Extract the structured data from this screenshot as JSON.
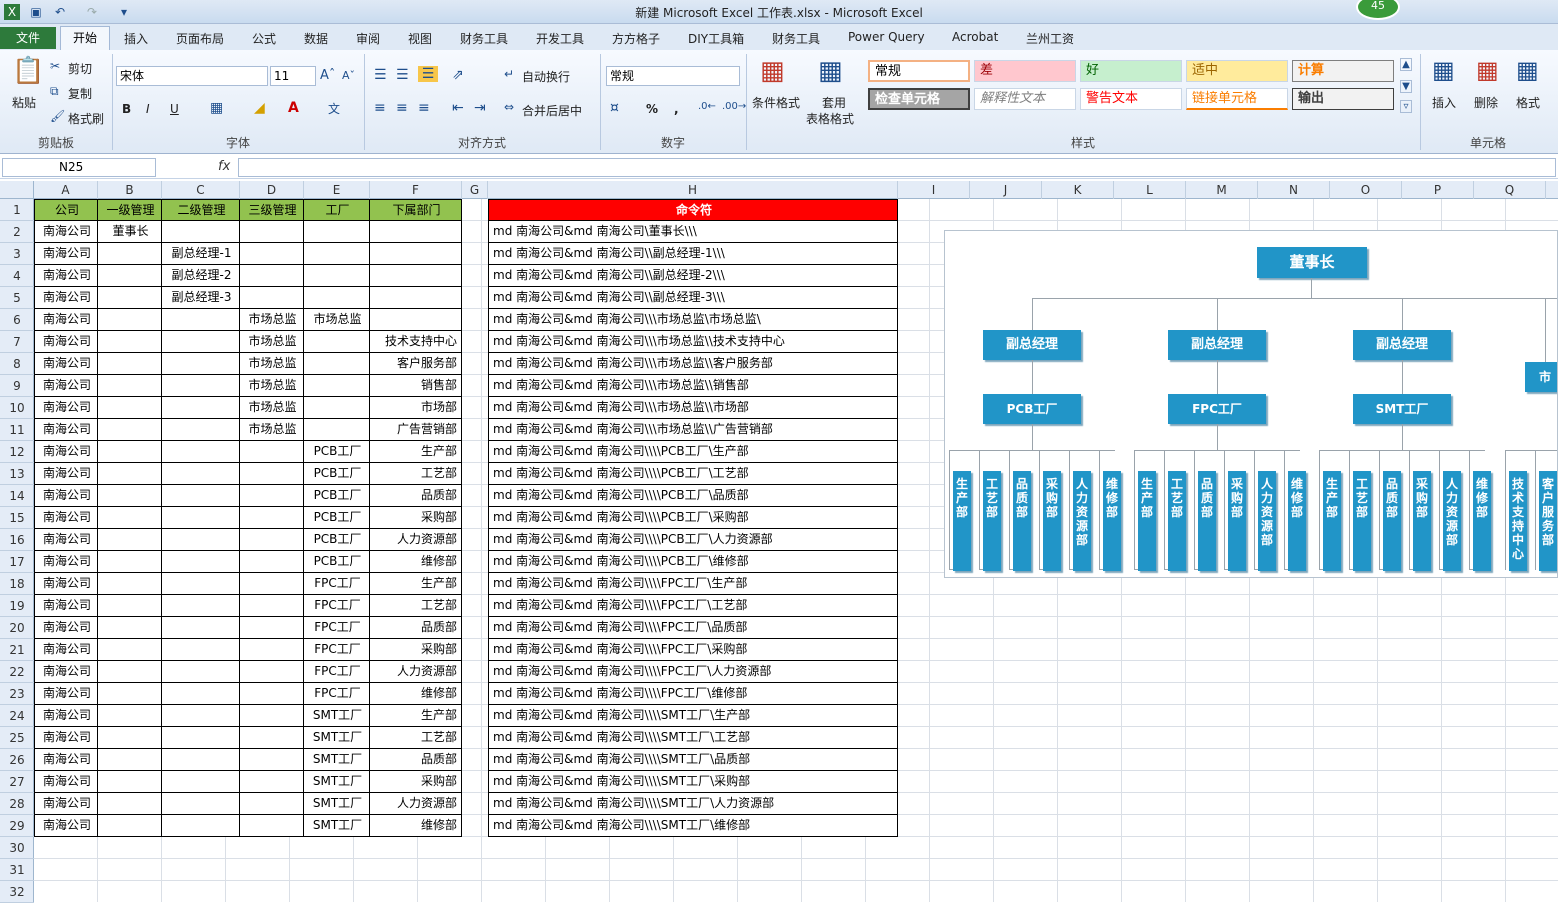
{
  "window": {
    "title": "新建 Microsoft Excel 工作表.xlsx - Microsoft Excel",
    "badge": "45"
  },
  "ribbon_tabs": [
    "文件",
    "开始",
    "插入",
    "页面布局",
    "公式",
    "数据",
    "审阅",
    "视图",
    "财务工具",
    "开发工具",
    "方方格子",
    "DIY工具箱",
    "财务工具",
    "Power Query",
    "Acrobat",
    "兰州工资"
  ],
  "ribbon": {
    "clipboard": {
      "paste": "粘贴",
      "cut": "剪切",
      "copy": "复制",
      "format_painter": "格式刷",
      "label": "剪贴板"
    },
    "font": {
      "name": "宋体",
      "size": "11",
      "bold": "B",
      "italic": "I",
      "underline": "U",
      "label": "字体"
    },
    "alignment": {
      "wrap": "自动换行",
      "merge": "合并后居中",
      "label": "对齐方式"
    },
    "number": {
      "format": "常规",
      "percent": "%",
      "comma": ",",
      "label": "数字"
    },
    "styles": {
      "cond_format": "条件格式",
      "table_format_1": "套用",
      "table_format_2": "表格格式",
      "cells": [
        {
          "text": "常规",
          "bg": "#ffffff",
          "color": "#000000"
        },
        {
          "text": "差",
          "bg": "#ffc7ce",
          "color": "#9c0006"
        },
        {
          "text": "好",
          "bg": "#c6efce",
          "color": "#006100"
        },
        {
          "text": "适中",
          "bg": "#ffeb9c",
          "color": "#9c6500"
        },
        {
          "text": "计算",
          "bg": "#f2f2f2",
          "color": "#fa7d00"
        },
        {
          "text": "检查单元格",
          "bg": "#a5a5a5",
          "color": "#ffffff"
        },
        {
          "text": "解释性文本",
          "bg": "#ffffff",
          "color": "#7f7f7f"
        },
        {
          "text": "警告文本",
          "bg": "#ffffff",
          "color": "#ff0000"
        },
        {
          "text": "链接单元格",
          "bg": "#ffffff",
          "color": "#fa7d00"
        },
        {
          "text": "输出",
          "bg": "#f2f2f2",
          "color": "#3f3f3f"
        }
      ],
      "label": "样式"
    },
    "cells_group": {
      "insert": "插入",
      "delete": "删除",
      "format": "格式",
      "label": "单元格"
    }
  },
  "formula_bar": {
    "name_box": "N25",
    "fx": "fx",
    "formula": ""
  },
  "columns": [
    "A",
    "B",
    "C",
    "D",
    "E",
    "F",
    "G",
    "H",
    "I",
    "J",
    "K",
    "L",
    "M",
    "N",
    "O",
    "P",
    "Q"
  ],
  "rows": [
    "1",
    "2",
    "3",
    "4",
    "5",
    "6",
    "7",
    "8",
    "9",
    "10",
    "11",
    "12",
    "13",
    "14",
    "15",
    "16",
    "17",
    "18",
    "19",
    "20",
    "21",
    "22",
    "23",
    "24",
    "25",
    "26",
    "27",
    "28",
    "29",
    "30",
    "31",
    "32"
  ],
  "table": {
    "headers": [
      "公司",
      "一级管理",
      "二级管理",
      "三级管理",
      "工厂",
      "下属部门"
    ],
    "command_header": "命令符",
    "data": [
      [
        "南海公司",
        "董事长",
        "",
        "",
        "",
        ""
      ],
      [
        "南海公司",
        "",
        "副总经理-1",
        "",
        "",
        ""
      ],
      [
        "南海公司",
        "",
        "副总经理-2",
        "",
        "",
        ""
      ],
      [
        "南海公司",
        "",
        "副总经理-3",
        "",
        "",
        ""
      ],
      [
        "南海公司",
        "",
        "",
        "市场总监",
        "市场总监",
        ""
      ],
      [
        "南海公司",
        "",
        "",
        "市场总监",
        "",
        "技术支持中心"
      ],
      [
        "南海公司",
        "",
        "",
        "市场总监",
        "",
        "客户服务部"
      ],
      [
        "南海公司",
        "",
        "",
        "市场总监",
        "",
        "销售部"
      ],
      [
        "南海公司",
        "",
        "",
        "市场总监",
        "",
        "市场部"
      ],
      [
        "南海公司",
        "",
        "",
        "市场总监",
        "",
        "广告营销部"
      ],
      [
        "南海公司",
        "",
        "",
        "",
        "PCB工厂",
        "生产部"
      ],
      [
        "南海公司",
        "",
        "",
        "",
        "PCB工厂",
        "工艺部"
      ],
      [
        "南海公司",
        "",
        "",
        "",
        "PCB工厂",
        "品质部"
      ],
      [
        "南海公司",
        "",
        "",
        "",
        "PCB工厂",
        "采购部"
      ],
      [
        "南海公司",
        "",
        "",
        "",
        "PCB工厂",
        "人力资源部"
      ],
      [
        "南海公司",
        "",
        "",
        "",
        "PCB工厂",
        "维修部"
      ],
      [
        "南海公司",
        "",
        "",
        "",
        "FPC工厂",
        "生产部"
      ],
      [
        "南海公司",
        "",
        "",
        "",
        "FPC工厂",
        "工艺部"
      ],
      [
        "南海公司",
        "",
        "",
        "",
        "FPC工厂",
        "品质部"
      ],
      [
        "南海公司",
        "",
        "",
        "",
        "FPC工厂",
        "采购部"
      ],
      [
        "南海公司",
        "",
        "",
        "",
        "FPC工厂",
        "人力资源部"
      ],
      [
        "南海公司",
        "",
        "",
        "",
        "FPC工厂",
        "维修部"
      ],
      [
        "南海公司",
        "",
        "",
        "",
        "SMT工厂",
        "生产部"
      ],
      [
        "南海公司",
        "",
        "",
        "",
        "SMT工厂",
        "工艺部"
      ],
      [
        "南海公司",
        "",
        "",
        "",
        "SMT工厂",
        "品质部"
      ],
      [
        "南海公司",
        "",
        "",
        "",
        "SMT工厂",
        "采购部"
      ],
      [
        "南海公司",
        "",
        "",
        "",
        "SMT工厂",
        "人力资源部"
      ],
      [
        "南海公司",
        "",
        "",
        "",
        "SMT工厂",
        "维修部"
      ]
    ],
    "commands": [
      "md 南海公司&md 南海公司\\董事长\\\\\\",
      "md 南海公司&md 南海公司\\\\副总经理-1\\\\\\",
      "md 南海公司&md 南海公司\\\\副总经理-2\\\\\\",
      "md 南海公司&md 南海公司\\\\副总经理-3\\\\\\",
      "md 南海公司&md 南海公司\\\\\\市场总监\\市场总监\\",
      "md 南海公司&md 南海公司\\\\\\市场总监\\\\技术支持中心",
      "md 南海公司&md 南海公司\\\\\\市场总监\\\\客户服务部",
      "md 南海公司&md 南海公司\\\\\\市场总监\\\\销售部",
      "md 南海公司&md 南海公司\\\\\\市场总监\\\\市场部",
      "md 南海公司&md 南海公司\\\\\\市场总监\\\\广告营销部",
      "md 南海公司&md 南海公司\\\\\\\\PCB工厂\\生产部",
      "md 南海公司&md 南海公司\\\\\\\\PCB工厂\\工艺部",
      "md 南海公司&md 南海公司\\\\\\\\PCB工厂\\品质部",
      "md 南海公司&md 南海公司\\\\\\\\PCB工厂\\采购部",
      "md 南海公司&md 南海公司\\\\\\\\PCB工厂\\人力资源部",
      "md 南海公司&md 南海公司\\\\\\\\PCB工厂\\维修部",
      "md 南海公司&md 南海公司\\\\\\\\FPC工厂\\生产部",
      "md 南海公司&md 南海公司\\\\\\\\FPC工厂\\工艺部",
      "md 南海公司&md 南海公司\\\\\\\\FPC工厂\\品质部",
      "md 南海公司&md 南海公司\\\\\\\\FPC工厂\\采购部",
      "md 南海公司&md 南海公司\\\\\\\\FPC工厂\\人力资源部",
      "md 南海公司&md 南海公司\\\\\\\\FPC工厂\\维修部",
      "md 南海公司&md 南海公司\\\\\\\\SMT工厂\\生产部",
      "md 南海公司&md 南海公司\\\\\\\\SMT工厂\\工艺部",
      "md 南海公司&md 南海公司\\\\\\\\SMT工厂\\品质部",
      "md 南海公司&md 南海公司\\\\\\\\SMT工厂\\采购部",
      "md 南海公司&md 南海公司\\\\\\\\SMT工厂\\人力资源部",
      "md 南海公司&md 南海公司\\\\\\\\SMT工厂\\维修部"
    ]
  },
  "org_chart": {
    "root": "董事长",
    "managers": [
      "副总经理",
      "副总经理",
      "副总经理"
    ],
    "factories": [
      "PCB工厂",
      "FPC工厂",
      "SMT工厂"
    ],
    "departments": [
      "生产部",
      "工艺部",
      "品质部",
      "采购部",
      "人力资源部",
      "维修部"
    ],
    "partial_box": "市",
    "partial_departments": [
      "技术支持中心",
      "客户服务部"
    ]
  },
  "colors": {
    "header_green": "#92c24f",
    "header_red": "#ff0000",
    "org_box": "#2195c8"
  }
}
